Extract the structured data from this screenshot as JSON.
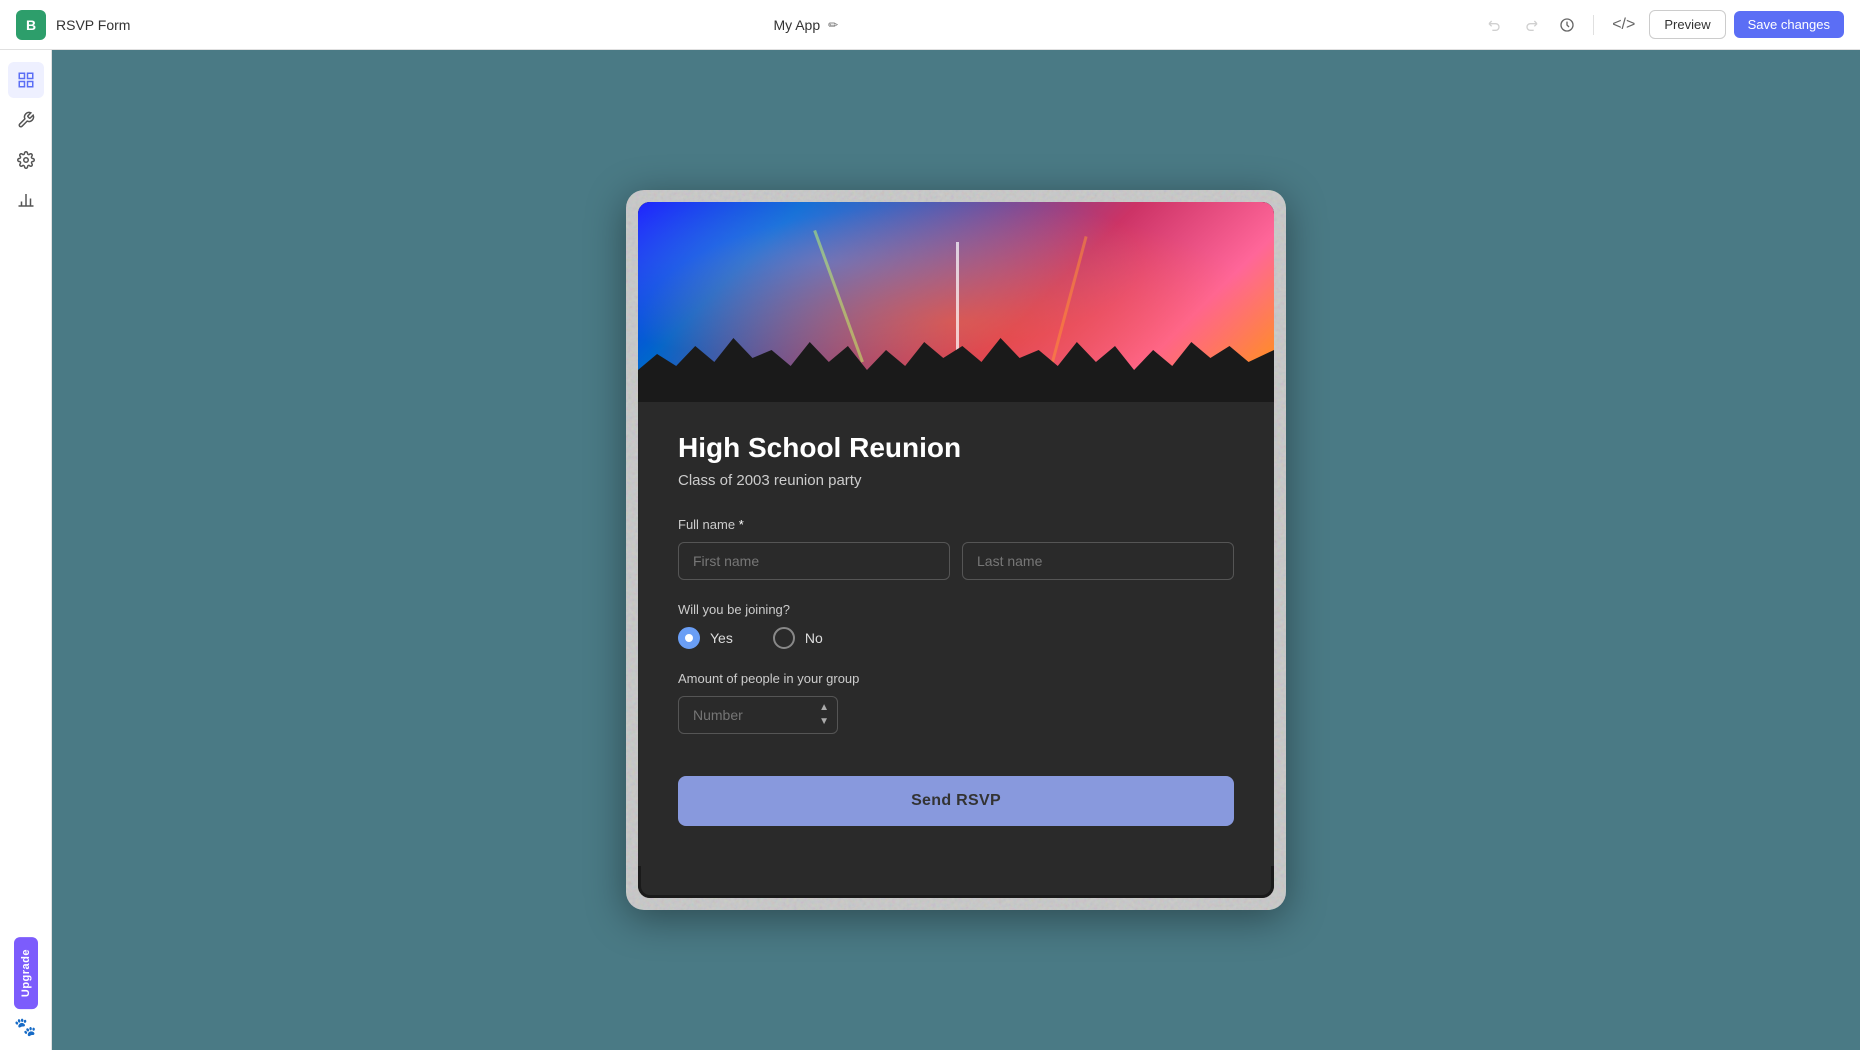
{
  "topbar": {
    "logo_text": "B",
    "app_name": "RSVP Form",
    "center_title": "My App",
    "edit_icon": "✏️",
    "undo_icon": "↩",
    "redo_icon": "↪",
    "history_icon": "⏱",
    "code_icon": "</>",
    "preview_label": "Preview",
    "save_label": "Save changes"
  },
  "sidebar": {
    "items": [
      {
        "icon": "⊞",
        "name": "grid-icon"
      },
      {
        "icon": "🔧",
        "name": "tools-icon"
      },
      {
        "icon": "⚙",
        "name": "settings-icon"
      },
      {
        "icon": "📊",
        "name": "analytics-icon"
      }
    ],
    "upgrade_label": "Upgrade",
    "paw_icon": "🐾"
  },
  "form": {
    "title": "High School Reunion",
    "subtitle": "Class of 2003 reunion party",
    "full_name_label": "Full name",
    "full_name_required": "*",
    "first_name_placeholder": "First name",
    "last_name_placeholder": "Last name",
    "joining_label": "Will you be joining?",
    "radio_yes": "Yes",
    "radio_no": "No",
    "group_label": "Amount of people in your group",
    "number_placeholder": "Number",
    "send_label": "Send RSVP"
  }
}
